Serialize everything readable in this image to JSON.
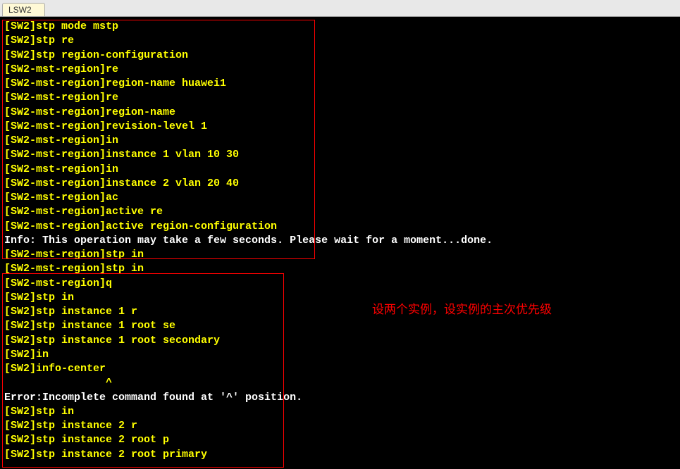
{
  "tab": {
    "label": "LSW2"
  },
  "annotation": "设两个实例，设实例的主次优先级",
  "lines": [
    {
      "cls": "yellow",
      "text": "[SW2]stp mode mstp"
    },
    {
      "cls": "yellow",
      "text": "[SW2]stp re"
    },
    {
      "cls": "yellow",
      "text": "[SW2]stp region-configuration"
    },
    {
      "cls": "yellow",
      "text": "[SW2-mst-region]re"
    },
    {
      "cls": "yellow",
      "text": "[SW2-mst-region]region-name huawei1"
    },
    {
      "cls": "yellow",
      "text": "[SW2-mst-region]re"
    },
    {
      "cls": "yellow",
      "text": "[SW2-mst-region]region-name"
    },
    {
      "cls": "yellow",
      "text": "[SW2-mst-region]revision-level 1"
    },
    {
      "cls": "yellow",
      "text": "[SW2-mst-region]in"
    },
    {
      "cls": "yellow",
      "text": "[SW2-mst-region]instance 1 vlan 10 30"
    },
    {
      "cls": "yellow",
      "text": "[SW2-mst-region]in"
    },
    {
      "cls": "yellow",
      "text": "[SW2-mst-region]instance 2 vlan 20 40"
    },
    {
      "cls": "yellow",
      "text": "[SW2-mst-region]ac"
    },
    {
      "cls": "yellow",
      "text": "[SW2-mst-region]active re"
    },
    {
      "cls": "yellow",
      "text": "[SW2-mst-region]active region-configuration"
    },
    {
      "cls": "white",
      "text": "Info: This operation may take a few seconds. Please wait for a moment...done."
    },
    {
      "cls": "yellow",
      "text": "[SW2-mst-region]stp in"
    },
    {
      "cls": "yellow",
      "text": "[SW2-mst-region]stp in"
    },
    {
      "cls": "yellow",
      "text": "[SW2-mst-region]q"
    },
    {
      "cls": "yellow",
      "text": "[SW2]stp in"
    },
    {
      "cls": "yellow",
      "text": "[SW2]stp instance 1 r"
    },
    {
      "cls": "yellow",
      "text": "[SW2]stp instance 1 root se"
    },
    {
      "cls": "yellow",
      "text": "[SW2]stp instance 1 root secondary"
    },
    {
      "cls": "yellow",
      "text": "[SW2]in"
    },
    {
      "cls": "yellow",
      "text": "[SW2]info-center"
    },
    {
      "cls": "yellow",
      "text": "                ^"
    },
    {
      "cls": "white",
      "text": "Error:Incomplete command found at '^' position."
    },
    {
      "cls": "yellow",
      "text": "[SW2]stp in"
    },
    {
      "cls": "yellow",
      "text": "[SW2]stp instance 2 r"
    },
    {
      "cls": "yellow",
      "text": "[SW2]stp instance 2 root p"
    },
    {
      "cls": "yellow",
      "text": "[SW2]stp instance 2 root primary"
    }
  ]
}
